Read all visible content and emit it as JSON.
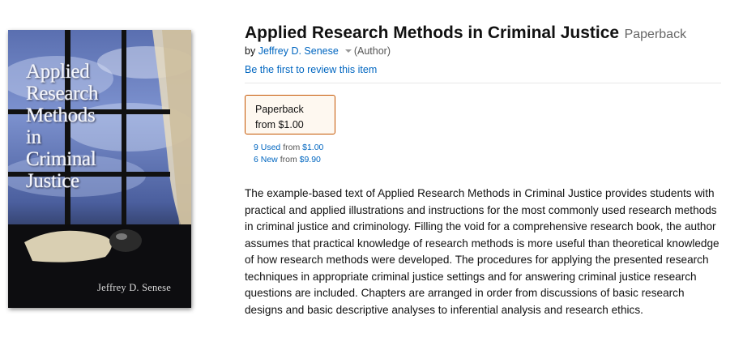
{
  "cover": {
    "title": "Applied\nResearch\nMethods\nin\nCriminal\nJustice",
    "author": "Jeffrey D. Senese"
  },
  "product": {
    "title": "Applied Research Methods in Criminal Justice",
    "format": "Paperback",
    "by_label": "by",
    "author": "Jeffrey D. Senese",
    "author_role": "(Author)",
    "review_link": "Be the first to review this item"
  },
  "format_box": {
    "label": "Paperback",
    "price": "from $1.00"
  },
  "offers": {
    "used_label": "9 Used",
    "used_from": "from",
    "used_price": "$1.00",
    "new_label": "6 New",
    "new_from": "from",
    "new_price": "$9.90"
  },
  "description": "The example-based text of Applied Research Methods in Criminal Justice provides students with practical and applied illustrations and instructions for the most commonly used research methods in criminal justice and criminology. Filling the void for a comprehensive research book, the author assumes that practical knowledge of research methods is more useful than theoretical knowledge of how research methods were developed. The procedures for applying the presented research techniques in appropriate criminal justice settings and for answering criminal justice research questions are included. Chapters are arranged in order from discussions of basic research designs and basic descriptive analyses to inferential analysis and research ethics.",
  "colors": {
    "link": "#0066c0",
    "selected_border": "#c45500",
    "selected_bg": "#fef8f0"
  }
}
